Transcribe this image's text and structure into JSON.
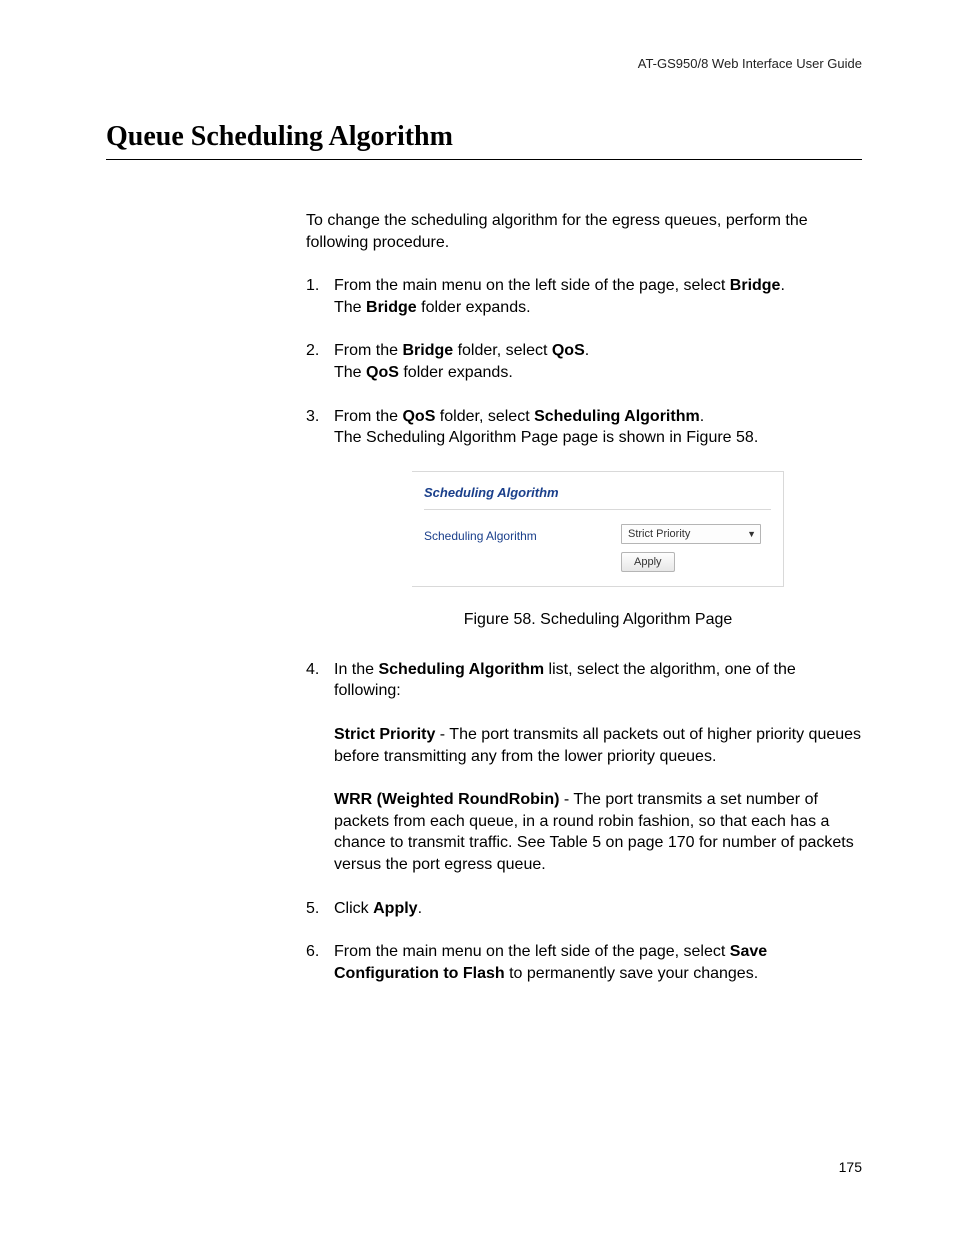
{
  "header": {
    "guide": "AT-GS950/8  Web Interface User Guide"
  },
  "title": "Queue Scheduling Algorithm",
  "intro": "To change the scheduling algorithm for the egress queues, perform the following procedure.",
  "steps": {
    "s1": {
      "num": "1.",
      "l1a": "From the main menu on the left side of the page, select ",
      "l1b": "Bridge",
      "l1c": ".",
      "l2a": "The ",
      "l2b": "Bridge",
      "l2c": " folder expands."
    },
    "s2": {
      "num": "2.",
      "l1a": "From the ",
      "l1b": "Bridge",
      "l1c": " folder, select ",
      "l1d": "QoS",
      "l1e": ".",
      "l2a": "The ",
      "l2b": "QoS",
      "l2c": " folder expands."
    },
    "s3": {
      "num": "3.",
      "l1a": "From the ",
      "l1b": "QoS",
      "l1c": " folder, select ",
      "l1d": "Scheduling Algorithm",
      "l1e": ".",
      "l2": "The Scheduling Algorithm Page page is shown in Figure 58."
    },
    "s4": {
      "num": "4.",
      "l1a": "In the ",
      "l1b": "Scheduling Algorithm",
      "l1c": " list, select the algorithm, one of the following:"
    },
    "s5": {
      "num": "5.",
      "l1a": "Click ",
      "l1b": "Apply",
      "l1c": "."
    },
    "s6": {
      "num": "6.",
      "l1a": "From the main menu on the left side of the page, select ",
      "l1b": "Save Configuration to Flash",
      "l1c": " to permanently save your changes."
    }
  },
  "options": {
    "opt1": {
      "b": "Strict Priority",
      "t": " - The port transmits all packets out of higher priority queues before transmitting any from the lower priority queues."
    },
    "opt2": {
      "b": "WRR (Weighted RoundRobin)",
      "t": " - The port transmits a set number of packets from each queue, in a round robin fashion, so that each has a chance to transmit traffic. See Table 5 on page 170 for number of packets versus the port egress queue."
    }
  },
  "figure": {
    "panel_title": "Scheduling Algorithm",
    "field_label": "Scheduling Algorithm",
    "selected": "Strict Priority",
    "apply": "Apply",
    "caption": "Figure 58. Scheduling Algorithm Page"
  },
  "page_number": "175"
}
